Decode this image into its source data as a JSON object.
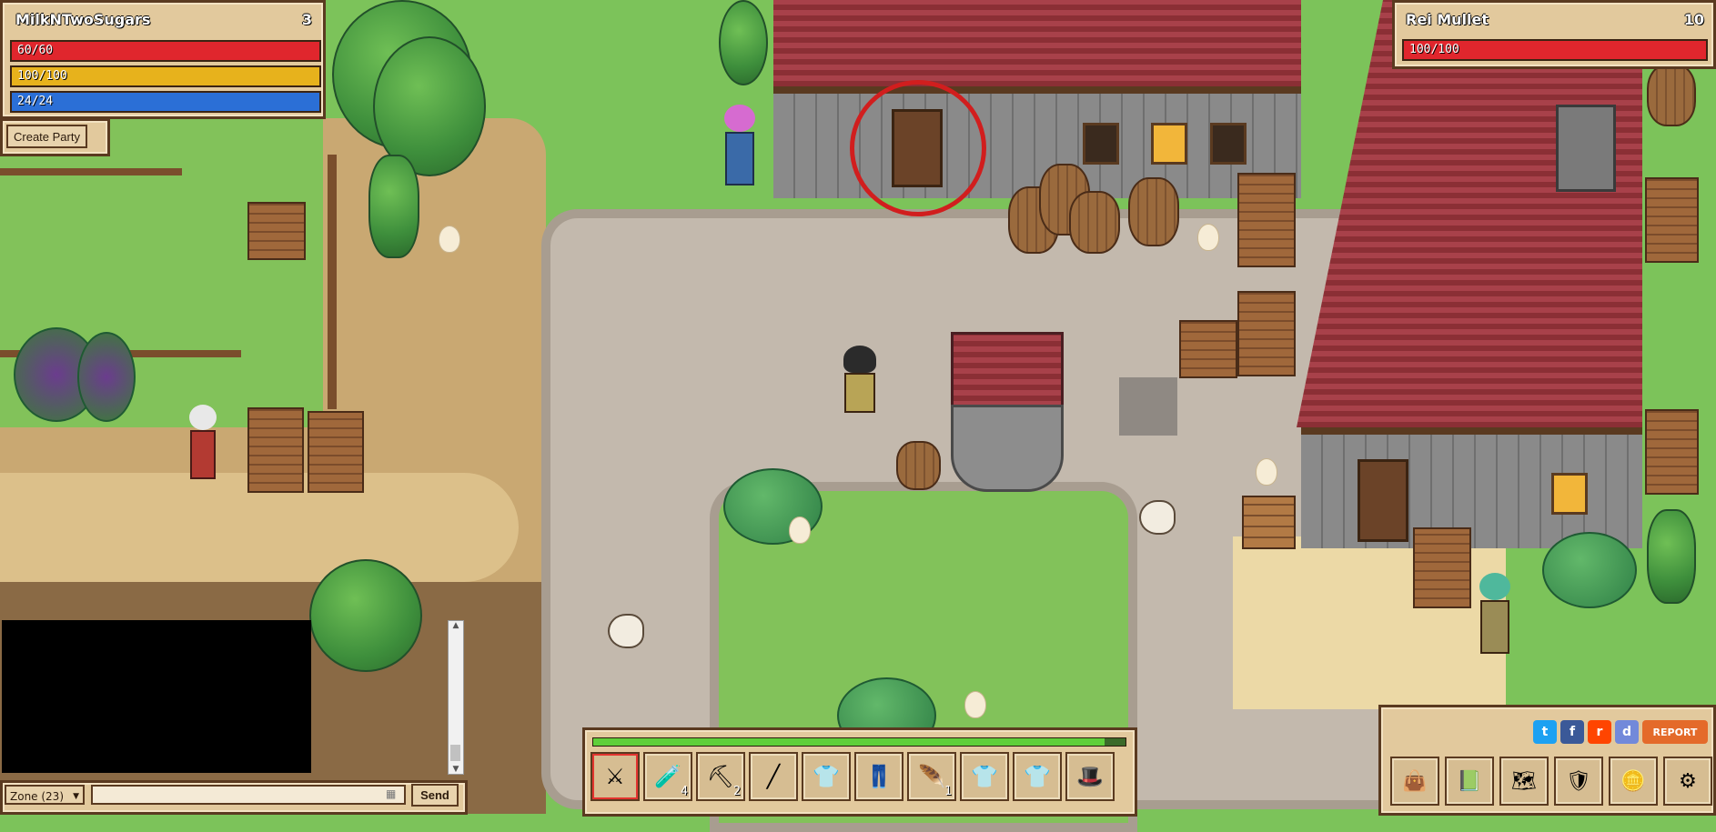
{
  "player": {
    "name": "MilkNTwoSugars",
    "level": "3",
    "hp": "60/60",
    "energy": "100/100",
    "mana": "24/24",
    "hp_pct": 1.0,
    "energy_pct": 1.0,
    "mana_pct": 1.0
  },
  "party": {
    "create_label": "Create Party"
  },
  "target": {
    "name": "Rei Mullet",
    "level": "10",
    "hp": "100/100",
    "hp_pct": 1.0
  },
  "chat": {
    "zone_label": "Zone (23)",
    "input_placeholder": "",
    "send_label": "Send"
  },
  "hotbar": {
    "xp_pct": 0.96,
    "slots": [
      {
        "icon": "sword-icon",
        "glyph": "⚔",
        "count": ""
      },
      {
        "icon": "potion-icon",
        "glyph": "🧪",
        "count": "4"
      },
      {
        "icon": "pickaxe-icon",
        "glyph": "⛏",
        "count": "2"
      },
      {
        "icon": "stick-icon",
        "glyph": "╱",
        "count": ""
      },
      {
        "icon": "shirt-icon",
        "glyph": "👕",
        "count": ""
      },
      {
        "icon": "pants-icon",
        "glyph": "👖",
        "count": ""
      },
      {
        "icon": "feather-icon",
        "glyph": "🪶",
        "count": "1"
      },
      {
        "icon": "tunic-icon",
        "glyph": "👕",
        "count": ""
      },
      {
        "icon": "tunic-icon",
        "glyph": "👕",
        "count": ""
      },
      {
        "icon": "hat-icon",
        "glyph": "🎩",
        "count": ""
      }
    ]
  },
  "social": {
    "twitter": "t",
    "facebook": "f",
    "reddit": "r",
    "discord": "d",
    "report_label": "REPORT"
  },
  "menu": [
    {
      "icon": "inventory-bag-icon",
      "glyph": "👜"
    },
    {
      "icon": "quest-book-icon",
      "glyph": "📗"
    },
    {
      "icon": "world-map-icon",
      "glyph": "🗺"
    },
    {
      "icon": "character-icon",
      "glyph": "🛡"
    },
    {
      "icon": "gold-coins-icon",
      "glyph": "🪙"
    },
    {
      "icon": "settings-gear-icon",
      "glyph": "⚙"
    }
  ],
  "colors": {
    "hp": "#e0262d",
    "energy": "#e7b21c",
    "mana": "#2b6fd6",
    "xp": "#5fcf3a"
  }
}
